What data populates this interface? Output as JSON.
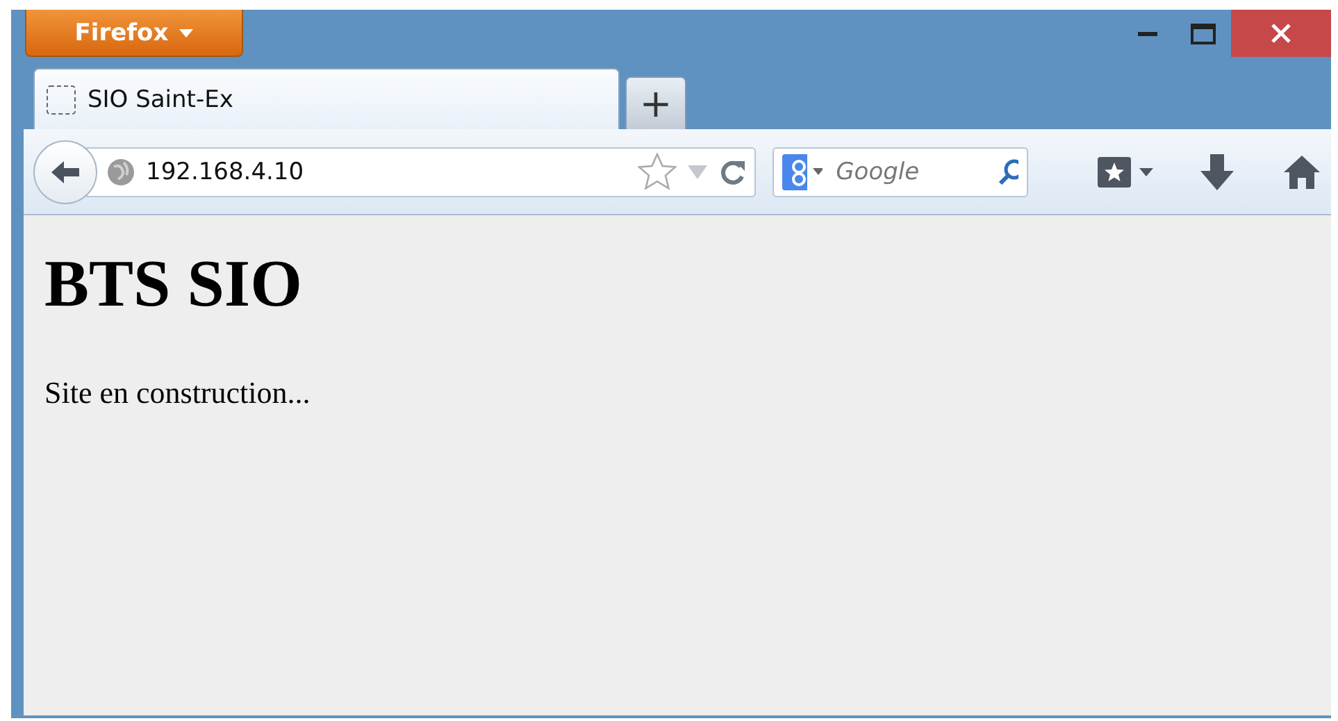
{
  "app_button": {
    "label": "Firefox"
  },
  "tabs": [
    {
      "title": "SIO Saint-Ex",
      "selected": true
    }
  ],
  "new_tab": {
    "label": "+"
  },
  "address_bar": {
    "value": "192.168.4.10"
  },
  "search": {
    "placeholder": "Google"
  },
  "page": {
    "heading": "BTS SIO",
    "paragraph": "Site en construction..."
  }
}
